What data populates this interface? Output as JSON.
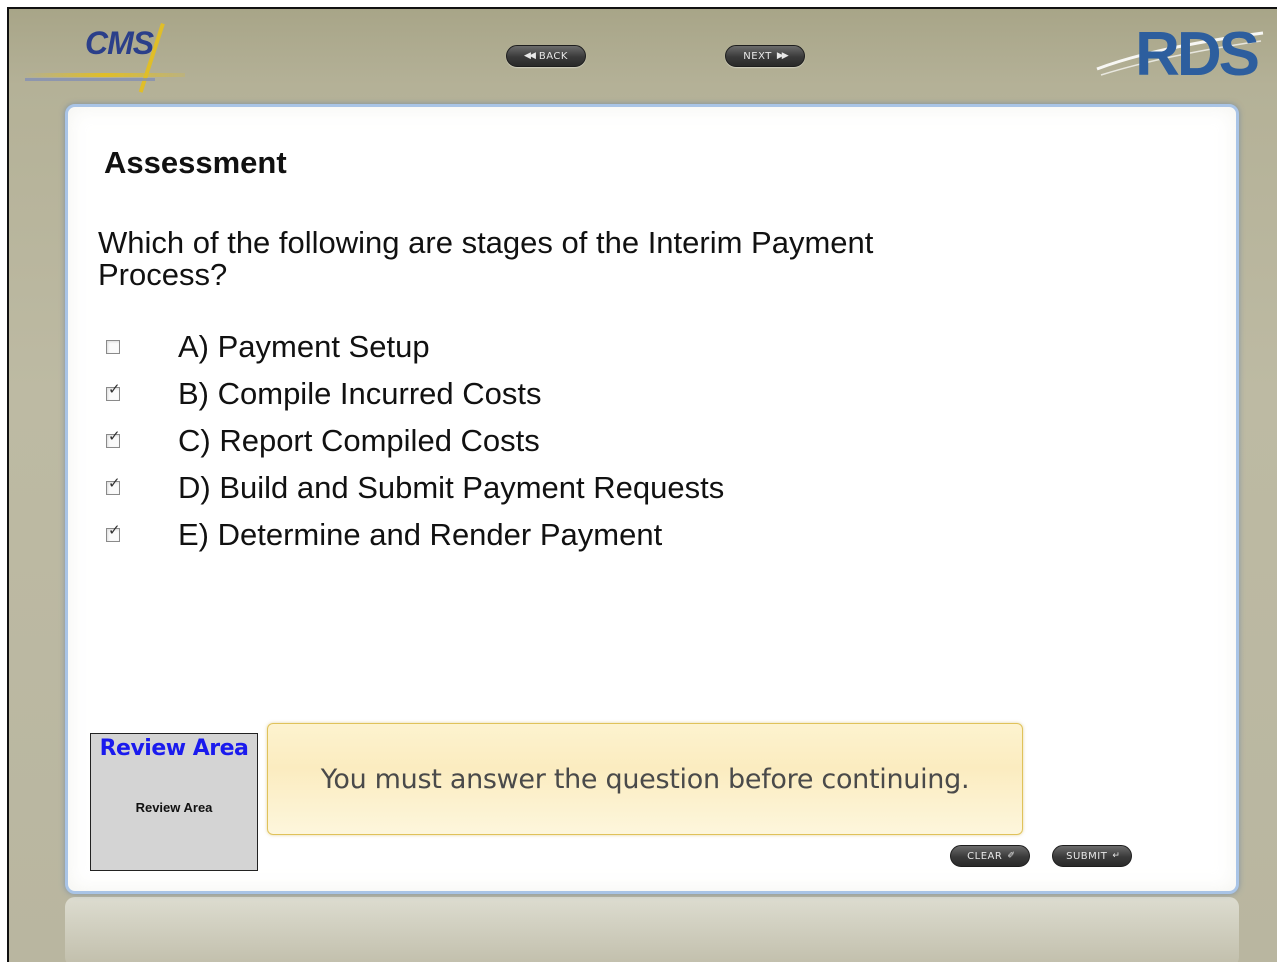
{
  "header": {
    "cms_logo_text": "CMS",
    "rds_logo_text": "RDS",
    "back_label": "BACK",
    "next_label": "NEXT",
    "back_icon": "rewind-icon",
    "next_icon": "fast-forward-icon"
  },
  "main": {
    "title": "Assessment",
    "question": "Which of the following are stages of the Interim Payment Process?",
    "options": [
      {
        "label": "A) Payment Setup",
        "checked": false
      },
      {
        "label": "B) Compile Incurred Costs",
        "checked": true
      },
      {
        "label": "C) Report Compiled Costs",
        "checked": true
      },
      {
        "label": "D) Build and Submit Payment Requests",
        "checked": true
      },
      {
        "label": "E) Determine and Render Payment",
        "checked": true
      }
    ],
    "review": {
      "title": "Review Area",
      "subtitle": "Review Area"
    },
    "message": "You must answer the question before continuing.",
    "clear_label": "CLEAR",
    "submit_label": "SUBMIT",
    "clear_icon": "eraser-icon",
    "submit_icon": "return-arrow-icon"
  },
  "colors": {
    "background": "#b7b49c",
    "panel_border": "#a9c4e6",
    "review_title": "#1a1aee",
    "message_bg": "#fbecc0"
  }
}
